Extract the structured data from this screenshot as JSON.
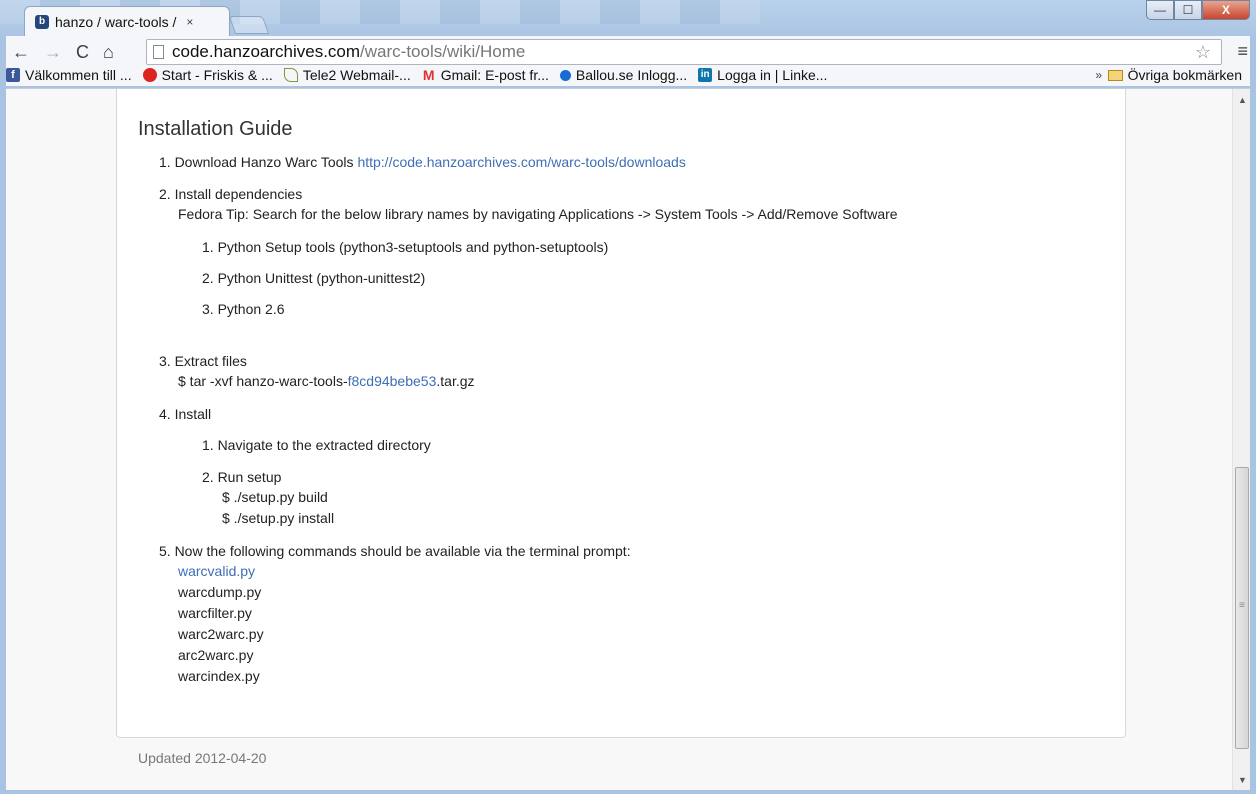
{
  "browser": {
    "tab_title": "hanzo / warc-tools /",
    "tab_close": "×",
    "url_host": "code.hanzoarchives.com",
    "url_path": "/warc-tools/wiki/Home"
  },
  "window_controls": {
    "min": "—",
    "max": "☐",
    "close": "X"
  },
  "toolbar": {
    "back": "←",
    "forward": "→",
    "reload": "C",
    "home": "⌂",
    "star": "☆",
    "menu": "≡"
  },
  "bookmarks": {
    "items": [
      {
        "label": "Välkommen till ...",
        "icon": "facebook-icon"
      },
      {
        "label": "Start - Friskis & ...",
        "icon": "friskis-icon"
      },
      {
        "label": "Tele2 Webmail-...",
        "icon": "tele2-icon"
      },
      {
        "label": "Gmail: E-post fr...",
        "icon": "gmail-icon"
      },
      {
        "label": "Ballou.se Inlogg...",
        "icon": "ballou-icon"
      },
      {
        "label": "Logga in | Linke...",
        "icon": "linkedin-icon"
      }
    ],
    "more": "»",
    "other": "Övriga bokmärken"
  },
  "wiki": {
    "heading": "Installation Guide",
    "step1_prefix": "1. Download Hanzo Warc Tools ",
    "step1_link": "http://code.hanzoarchives.com/warc-tools/downloads",
    "step2_title": "2. Install dependencies",
    "step2_tip": "Fedora Tip: Search for the below library names by navigating Applications -> System Tools -> Add/Remove Software",
    "step2_sub1": "1. Python Setup tools (python3-setuptools and python-setuptools)",
    "step2_sub2": "2. Python Unittest (python-unittest2)",
    "step2_sub3": "3. Python 2.6",
    "step3_title": "3. Extract files",
    "step3_cmd_prefix": "$ tar -xvf hanzo-warc-tools-",
    "step3_cmd_link": "f8cd94bebe53",
    "step3_cmd_suffix": ".tar.gz",
    "step4_title": "4. Install",
    "step4_sub1": "1. Navigate to the extracted directory",
    "step4_sub2": "2. Run setup",
    "step4_cmd1": "$ ./setup.py build",
    "step4_cmd2": "$ ./setup.py install",
    "step5_title": "5. Now the following commands should be available via the terminal prompt:",
    "commands": [
      "warcvalid.py",
      "warcdump.py",
      "warcfilter.py",
      "warc2warc.py",
      "arc2warc.py",
      "warcindex.py"
    ]
  },
  "footer": {
    "updated": "Updated 2012-04-20"
  },
  "scrollbar": {
    "up": "▲",
    "down": "▼",
    "grip": "≡",
    "position": 0.88
  }
}
